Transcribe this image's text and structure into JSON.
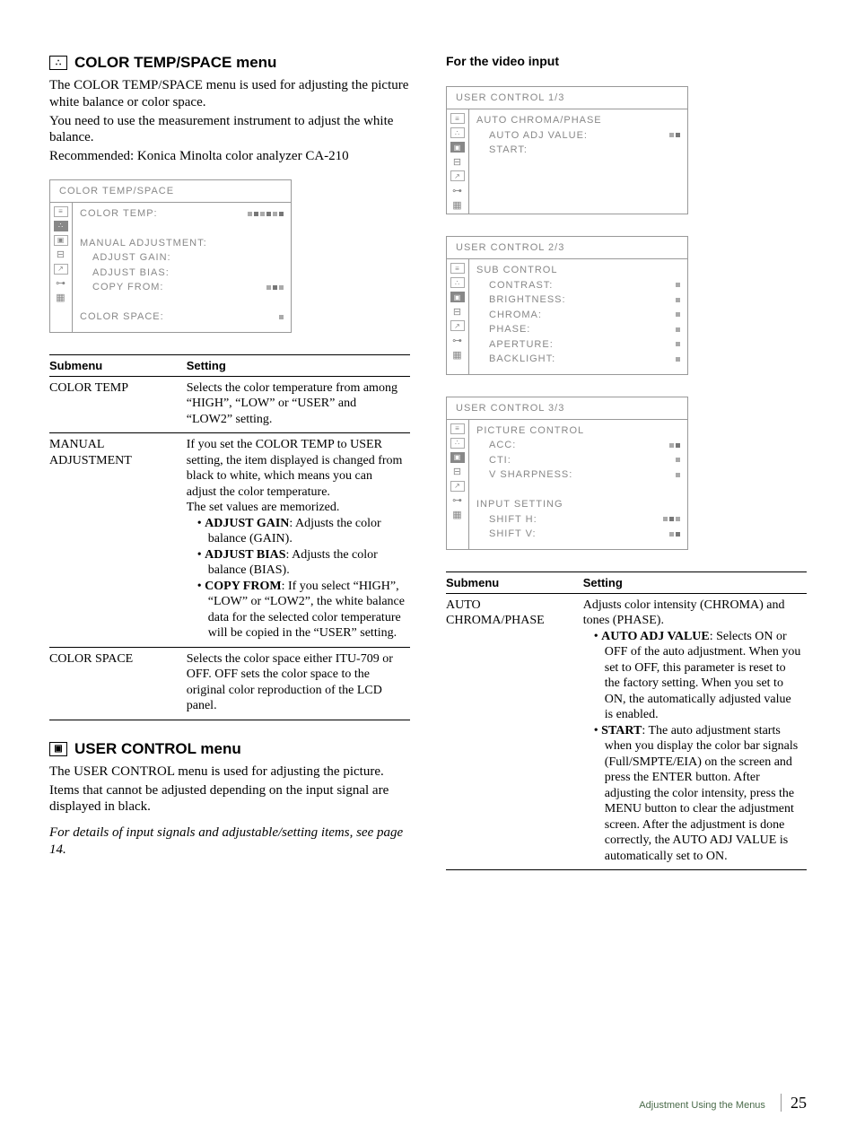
{
  "left": {
    "title1": "COLOR TEMP/SPACE menu",
    "p1": "The COLOR TEMP/SPACE menu is used for adjusting the picture white balance or color space.",
    "p2": "You need to use the measurement instrument to adjust the white balance.",
    "p3": "Recommended: Konica Minolta color analyzer CA-210",
    "osd1": {
      "title": "COLOR TEMP/SPACE",
      "rows": [
        {
          "label": "COLOR TEMP:",
          "dots": 6,
          "indent": false
        },
        {
          "label": " ",
          "dots": 0,
          "indent": false
        },
        {
          "label": "MANUAL ADJUSTMENT:",
          "dots": 0,
          "indent": false
        },
        {
          "label": "ADJUST GAIN:",
          "dots": 0,
          "indent": true
        },
        {
          "label": "ADJUST BIAS:",
          "dots": 0,
          "indent": true
        },
        {
          "label": "COPY FROM:",
          "dots": 3,
          "indent": true
        },
        {
          "label": " ",
          "dots": 0,
          "indent": false
        },
        {
          "label": "COLOR SPACE:",
          "dots": 1,
          "indent": false
        }
      ]
    },
    "table1": {
      "headers": [
        "Submenu",
        "Setting"
      ],
      "rows": [
        {
          "name": "COLOR TEMP",
          "setting_plain": "Selects the color temperature from among “HIGH”, “LOW” or “USER” and “LOW2” setting."
        },
        {
          "name": "MANUAL ADJUSTMENT",
          "setting_pre": "If you set the COLOR TEMP to USER setting, the item displayed is changed from black to white, which means you can adjust the color temperature.\nThe set values are memorized.",
          "bullets": [
            {
              "b": "ADJUST GAIN",
              "t": ": Adjusts the color balance (GAIN)."
            },
            {
              "b": "ADJUST BIAS",
              "t": ": Adjusts the color balance (BIAS)."
            },
            {
              "b": "COPY FROM",
              "t": ": If you select “HIGH”, “LOW” or “LOW2”, the white balance data for the selected color temperature will be copied in the “USER” setting."
            }
          ]
        },
        {
          "name": "COLOR SPACE",
          "setting_plain": "Selects the color space either ITU-709 or OFF.  OFF sets the color space to the original color reproduction of the LCD panel."
        }
      ]
    },
    "title2": "USER CONTROL menu",
    "p4": "The USER CONTROL menu is used for adjusting the picture.",
    "p5": "Items that cannot be adjusted depending on the input signal are displayed in black.",
    "p6": "For details of input signals and adjustable/setting items, see page 14."
  },
  "right": {
    "heading": "For the video input",
    "osd2": {
      "title": "USER CONTROL 1/3",
      "rows": [
        {
          "label": "AUTO CHROMA/PHASE",
          "dots": 0,
          "indent": false
        },
        {
          "label": "AUTO ADJ VALUE:",
          "dots": 2,
          "indent": true
        },
        {
          "label": "START:",
          "dots": 0,
          "indent": true
        }
      ]
    },
    "osd3": {
      "title": "USER CONTROL 2/3",
      "rows": [
        {
          "label": "SUB CONTROL",
          "dots": 0,
          "indent": false
        },
        {
          "label": "CONTRAST:",
          "dots": 1,
          "indent": true
        },
        {
          "label": "BRIGHTNESS:",
          "dots": 1,
          "indent": true
        },
        {
          "label": "CHROMA:",
          "dots": 1,
          "indent": true
        },
        {
          "label": "PHASE:",
          "dots": 1,
          "indent": true
        },
        {
          "label": "APERTURE:",
          "dots": 1,
          "indent": true
        },
        {
          "label": "BACKLIGHT:",
          "dots": 1,
          "indent": true
        }
      ]
    },
    "osd4": {
      "title": "USER CONTROL 3/3",
      "rows": [
        {
          "label": "PICTURE CONTROL",
          "dots": 0,
          "indent": false
        },
        {
          "label": "ACC:",
          "dots": 2,
          "indent": true
        },
        {
          "label": "CTI:",
          "dots": 1,
          "indent": true
        },
        {
          "label": "V SHARPNESS:",
          "dots": 1,
          "indent": true
        },
        {
          "label": " ",
          "dots": 0,
          "indent": false
        },
        {
          "label": "INPUT SETTING",
          "dots": 0,
          "indent": false
        },
        {
          "label": "SHIFT H:",
          "dots": 3,
          "indent": true
        },
        {
          "label": "SHIFT V:",
          "dots": 2,
          "indent": true
        }
      ]
    },
    "table2": {
      "headers": [
        "Submenu",
        "Setting"
      ],
      "rows": [
        {
          "name": "AUTO CHROMA/PHASE",
          "setting_pre": "Adjusts color intensity (CHROMA) and tones (PHASE).",
          "bullets": [
            {
              "b": "AUTO ADJ VALUE",
              "t": ": Selects ON or OFF of the auto adjustment.  When you set to OFF, this parameter is reset to the factory setting.  When you set to ON, the automatically adjusted value is enabled."
            },
            {
              "b": "START",
              "t": ": The auto adjustment starts when you display the color bar signals (Full/SMPTE/EIA) on the screen and press the ENTER button.  After adjusting the color intensity, press the MENU button to clear the adjustment screen. After the adjustment is done correctly, the AUTO ADJ VALUE is automatically set to ON."
            }
          ]
        }
      ]
    }
  },
  "footer": {
    "label": "Adjustment Using the Menus",
    "page": "25"
  }
}
